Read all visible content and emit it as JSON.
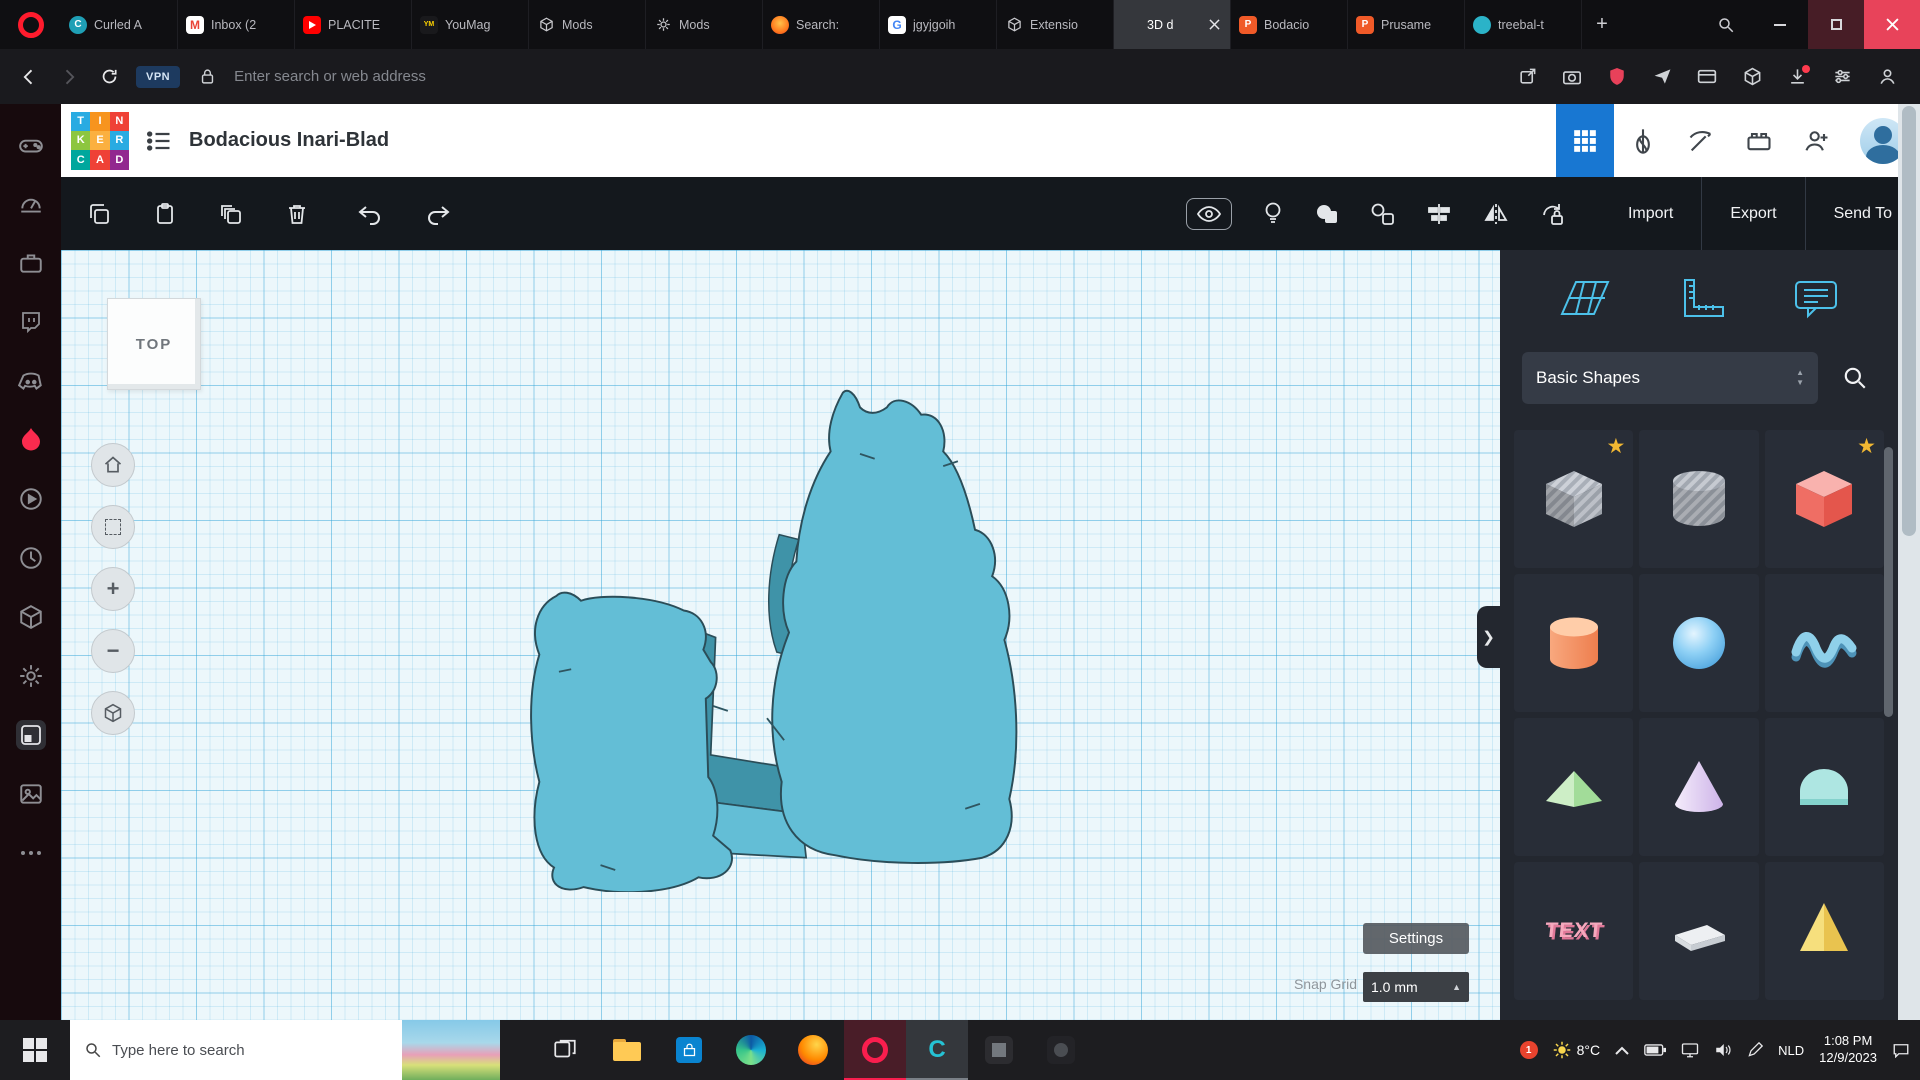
{
  "ui": {
    "plus": "+",
    "zoom_in": "+",
    "zoom_out": "−",
    "spin_up": "▲",
    "spin_down": "▼",
    "snap_arrow": "▲",
    "star": "★",
    "chevron": "❯"
  },
  "browser": {
    "tabs": [
      {
        "label": "Curled A",
        "icon": "curled",
        "glyph": "C"
      },
      {
        "label": "Inbox (2",
        "icon": "gmail",
        "glyph": "M"
      },
      {
        "label": "PLACITE",
        "icon": "youtube"
      },
      {
        "label": "YouMag",
        "icon": "youmag",
        "glyph": "YM"
      },
      {
        "label": "Mods",
        "icon": "box"
      },
      {
        "label": "Mods",
        "icon": "gear"
      },
      {
        "label": "Search:",
        "icon": "flame"
      },
      {
        "label": "jgyjgoih",
        "icon": "google",
        "glyph": "G"
      },
      {
        "label": "Extensio",
        "icon": "box"
      },
      {
        "label": "3D d",
        "icon": "tinkercad",
        "active": true
      },
      {
        "label": "Bodacio",
        "icon": "prusa",
        "glyph": "P"
      },
      {
        "label": "Prusame",
        "icon": "prusa",
        "glyph": "P"
      },
      {
        "label": "treebal-t",
        "icon": "treebal"
      }
    ],
    "address": {
      "vpn": "VPN",
      "placeholder": "Enter search or web address"
    }
  },
  "tinkercad": {
    "title": "Bodacious Inari-Blad",
    "logo_letters": [
      "T",
      "I",
      "N",
      "K",
      "E",
      "R",
      "C",
      "A",
      "D"
    ],
    "toolbar": {
      "import": "Import",
      "export": "Export",
      "send_to": "Send To"
    },
    "viewcube": "TOP",
    "panel": {
      "category": "Basic Shapes",
      "shapes": [
        "Box",
        "Cylinder",
        "Box",
        "Cylinder",
        "Sphere",
        "Scribble",
        "Pyramid",
        "Cone",
        "Round Roof",
        "Text",
        "Polygon",
        "Pyramid"
      ],
      "text_tile": "TEXT"
    },
    "canvas": {
      "settings": "Settings",
      "snap_label": "Snap Grid",
      "snap_value": "1.0 mm"
    }
  },
  "taskbar": {
    "search_placeholder": "Type here to search",
    "weather": "8°C",
    "badge": "1",
    "lang": "NLD",
    "time": "1:08 PM",
    "date": "12/9/2023"
  },
  "colors": {
    "opera_red": "#fa1e4e",
    "accent_blue": "#1877d2",
    "panel_teal": "#4cc1ea",
    "shape_fill": "#63bed6",
    "shape_side": "#3f93a8",
    "shield_red": "#e8415a",
    "close_red": "#e8435a",
    "canvas_bg": "#ecf7fb"
  }
}
